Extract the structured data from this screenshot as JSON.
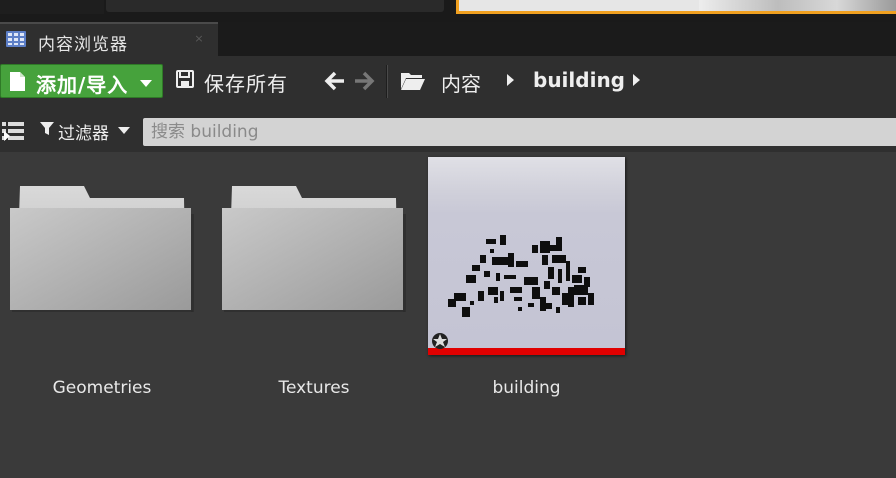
{
  "tab": {
    "title": "内容浏览器",
    "close": "×"
  },
  "toolbar": {
    "add_import_label": "添加/导入",
    "save_all_label": "保存所有",
    "breadcrumbs": [
      "内容",
      "building"
    ]
  },
  "filters": {
    "filter_label": "过滤器",
    "search_placeholder": "搜索 building"
  },
  "assets": [
    {
      "name": "Geometries",
      "type": "folder"
    },
    {
      "name": "Textures",
      "type": "folder"
    },
    {
      "name": "building",
      "type": "map",
      "accent": "#e00000"
    }
  ],
  "colors": {
    "add_button": "#46a23c",
    "asset_underline": "#e00000",
    "search_bg": "#d3d3d3"
  },
  "icons": [
    "content-browser-icon",
    "close-icon",
    "new-document-icon",
    "chevron-down-icon",
    "save-icon",
    "arrow-left-icon",
    "arrow-right-icon",
    "folder-open-icon",
    "chevron-right-icon",
    "tree-view-icon",
    "funnel-icon",
    "folder-icon",
    "map-asset-star-icon"
  ]
}
